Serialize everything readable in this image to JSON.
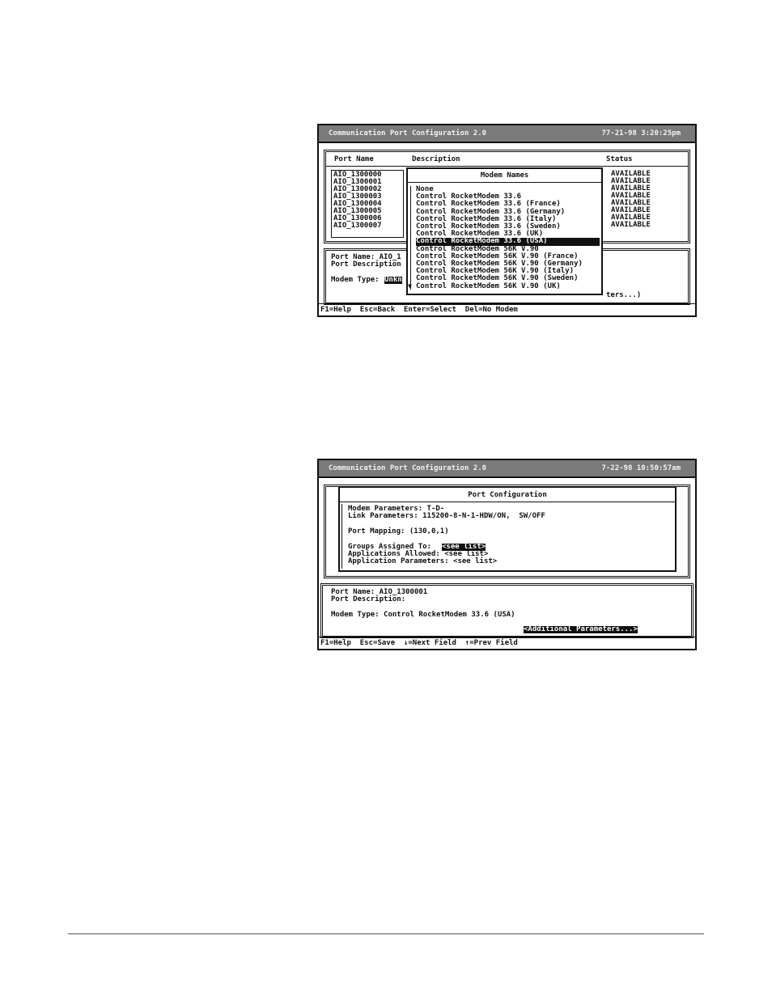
{
  "screen1": {
    "title": "Communication Port Configuration  2.0",
    "datetime": "77-21-98 3:20:25pm",
    "headers": [
      "Port Name",
      "Description",
      "Status"
    ],
    "ports": [
      "AIO_1300000",
      "AIO_1300001",
      "AIO_1300002",
      "AIO_1300003",
      "AIO_1300004",
      "AIO_1300005",
      "AIO_1300006",
      "AIO_1300007"
    ],
    "statuses": [
      "AVAILABLE",
      "AVAILABLE",
      "AVAILABLE",
      "AVAILABLE",
      "AVAILABLE",
      "AVAILABLE",
      "AVAILABLE",
      "AVAILABLE"
    ],
    "popup_title": "Modem Names",
    "modems": [
      "None",
      "Control RocketModem 33.6",
      "Control RocketModem 33.6 (France)",
      "Control RocketModem 33.6 (Germany)",
      "Control RocketModem 33.6 (Italy)",
      "Control RocketModem 33.6 (Sweden)",
      "Control RocketModem 33.6 (UK)",
      "Control RocketModem 33.6 (USA)",
      "Control RocketModem 56K V.90",
      "Control RocketModem 56K V.90 (France)",
      "Control RocketModem 56K V.90 (Germany)",
      "Control RocketModem 56K V.90 (Italy)",
      "Control RocketModem 56K V.90 (Sweden)",
      "Control RocketModem 56K V.90 (UK)"
    ],
    "selected_index": 7,
    "scroll_arrow": "▼",
    "port_name_label": "Port Name: AIO_1",
    "port_desc_label": "Port Description",
    "modem_type_label": "Modem Type:",
    "modem_type_value": "Unkn",
    "params_tail": "ters...)",
    "footer": "F1=Help  Esc=Back  Enter=Select  Del=No Modem"
  },
  "screen2": {
    "title": "Communication Port Configuration  2.0",
    "datetime": "7-22-98 10:50:57am",
    "dialog_title": "Port Configuration",
    "modem_params": "Modem Parameters: T-D-",
    "link_params": "Link Parameters: 115200-8-N-1-HDW/ON,  SW/OFF",
    "port_mapping": "Port Mapping: (130,0,1)",
    "groups_label": "Groups Assigned To:",
    "groups_value": "<see list>",
    "apps_allowed": "Applications Allowed: <see list>",
    "app_params": "Application Parameters: <see list>",
    "port_name": "Port Name: AIO_1300001",
    "port_desc": "Port Description:",
    "modem_type": "Modem Type: Control RocketModem 33.6 (USA)",
    "additional": "<Additional Parameters...>",
    "footer": "F1=Help  Esc=Save  ↓=Next Field  ↑=Prev Field"
  }
}
